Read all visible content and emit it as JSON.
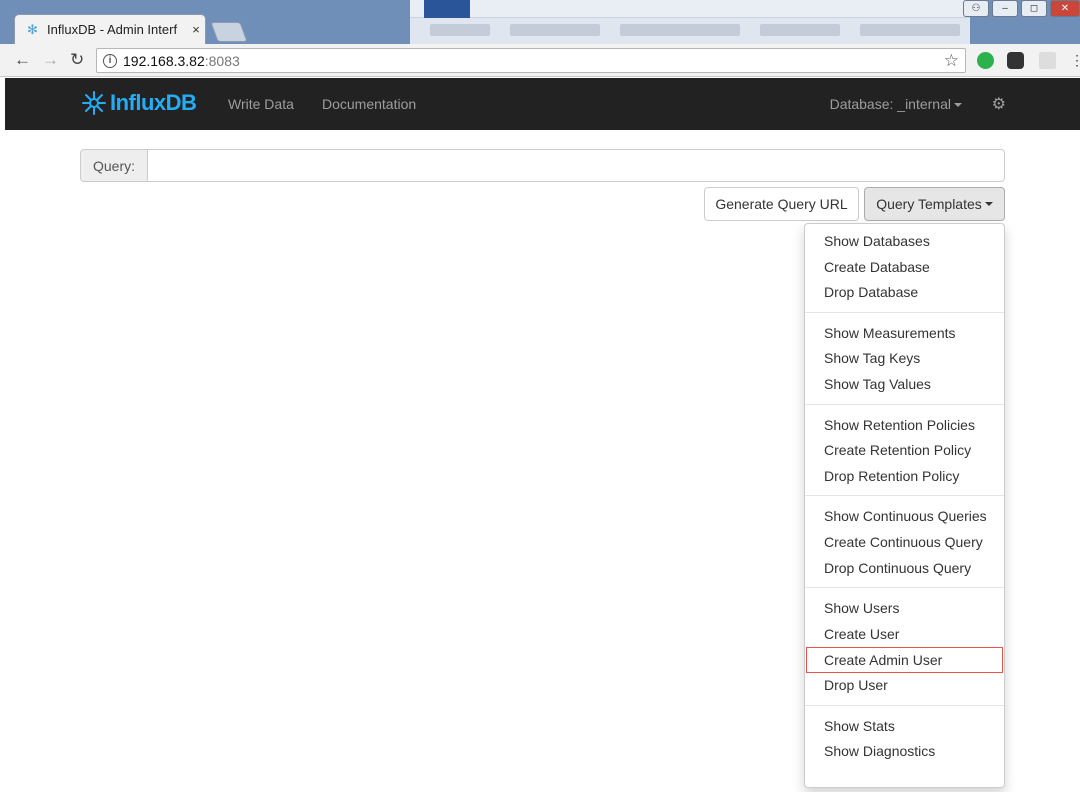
{
  "browser": {
    "tab_title": "InfluxDB - Admin Interf",
    "tab_close": "×",
    "url_host": "192.168.3.82",
    "url_port": ":8083"
  },
  "navbar": {
    "brand_influx": "Influx",
    "brand_db": "DB",
    "links": [
      "Write Data",
      "Documentation"
    ],
    "database_label": "Database: _internal"
  },
  "query": {
    "label": "Query:",
    "value": ""
  },
  "buttons": {
    "generate_url": "Generate Query URL",
    "templates": "Query Templates"
  },
  "templates_menu": {
    "groups": [
      [
        "Show Databases",
        "Create Database",
        "Drop Database"
      ],
      [
        "Show Measurements",
        "Show Tag Keys",
        "Show Tag Values"
      ],
      [
        "Show Retention Policies",
        "Create Retention Policy",
        "Drop Retention Policy"
      ],
      [
        "Show Continuous Queries",
        "Create Continuous Query",
        "Drop Continuous Query"
      ],
      [
        "Show Users",
        "Create User",
        "Create Admin User",
        "Drop User"
      ],
      [
        "Show Stats",
        "Show Diagnostics"
      ]
    ],
    "highlighted_item": "Create Admin User"
  },
  "colors": {
    "brand": "#22adf6",
    "navbar_bg": "#222222",
    "highlight_border": "#e5534b"
  }
}
